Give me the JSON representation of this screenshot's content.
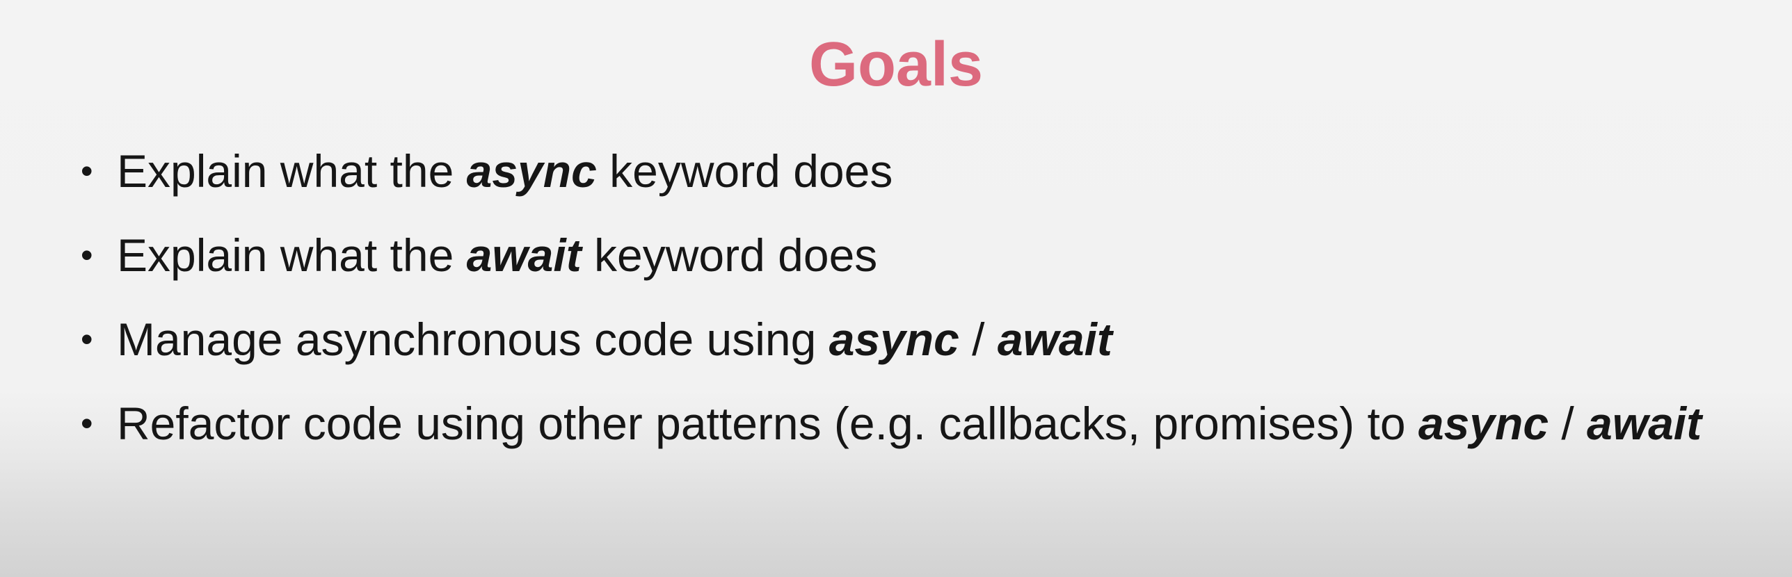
{
  "slide": {
    "title": "Goals",
    "title_color": "#dc6a7e",
    "bullet_symbol": "•",
    "goals": [
      {
        "pre": "Explain what the ",
        "keyword": "async",
        "post": " keyword does"
      },
      {
        "pre": "Explain what the ",
        "keyword": "await",
        "post": " keyword does"
      },
      {
        "pre": "Manage asynchronous code using ",
        "keyword_1": "async",
        "separator": " / ",
        "keyword_2": "await"
      },
      {
        "pre": "Refactor code using other patterns (e.g. callbacks, promises) to ",
        "keyword_1": "async",
        "separator": " / ",
        "keyword_2": "await"
      }
    ]
  }
}
